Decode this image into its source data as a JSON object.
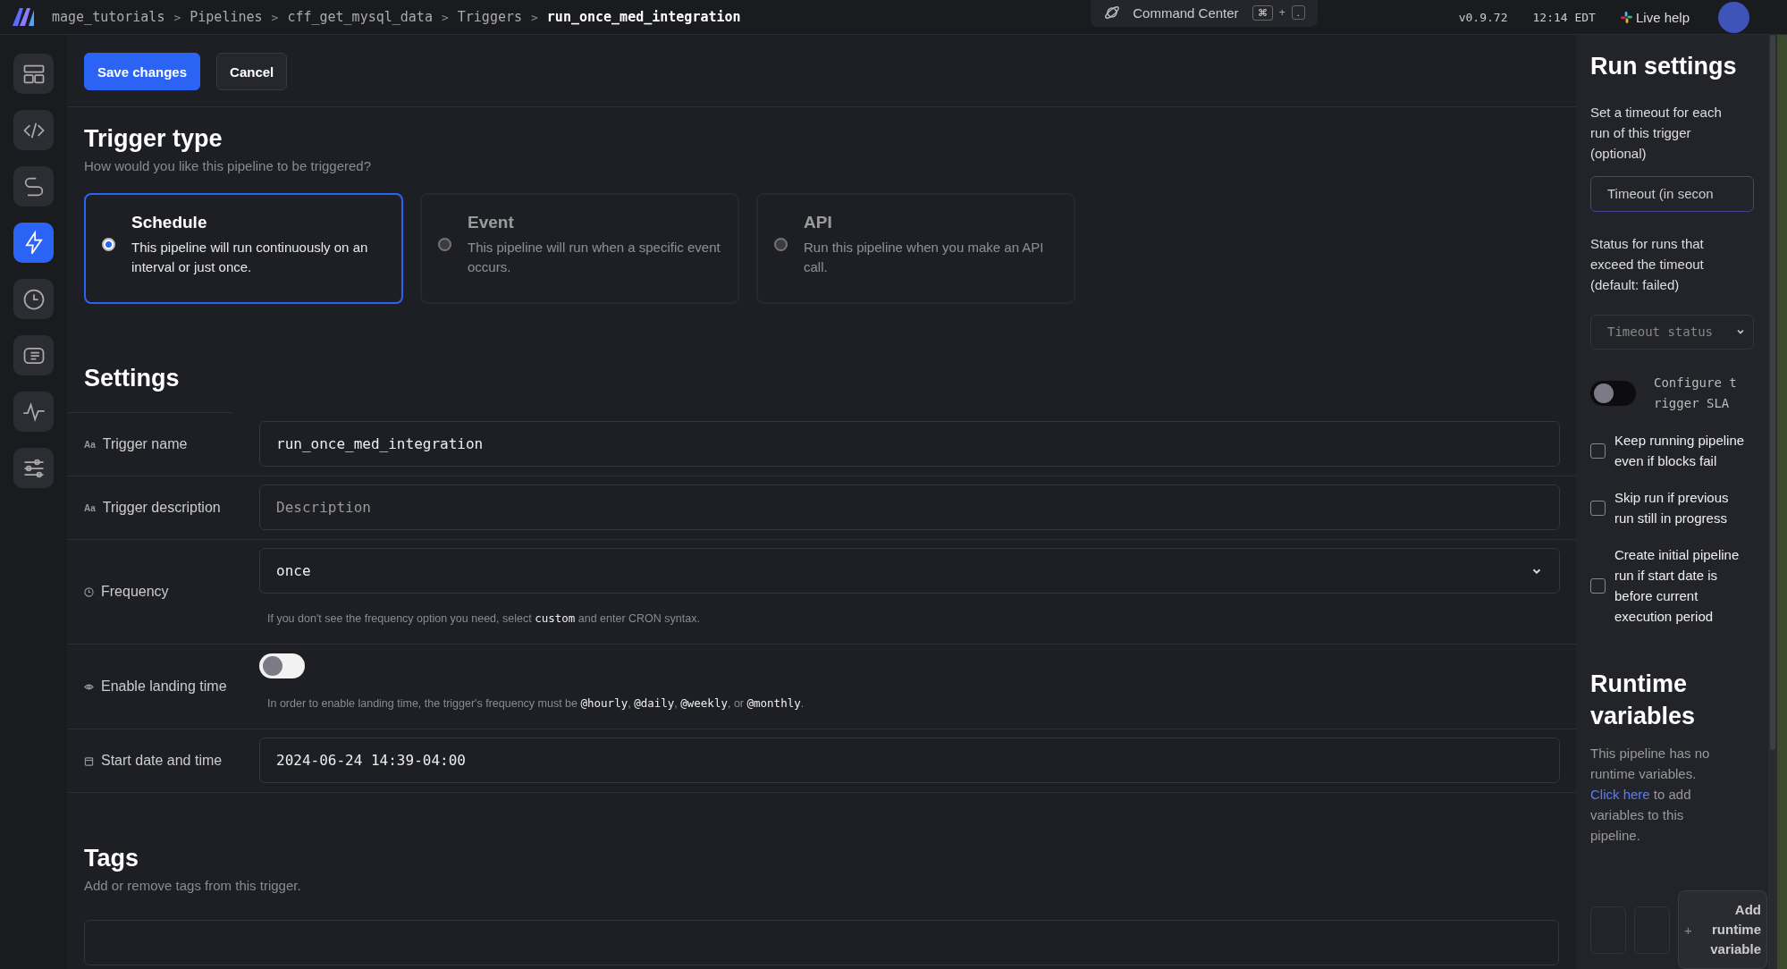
{
  "header": {
    "breadcrumbs": [
      {
        "label": "mage_tutorials",
        "current": false
      },
      {
        "label": "Pipelines",
        "current": false
      },
      {
        "label": "cff_get_mysql_data",
        "current": false
      },
      {
        "label": "Triggers",
        "current": false
      },
      {
        "label": "run_once_med_integration",
        "current": true
      }
    ],
    "separator": ">",
    "command_center": {
      "label": "Command Center",
      "keys": [
        "⌘",
        "+",
        "."
      ]
    },
    "version": "v0.9.72",
    "time": "12:14 EDT",
    "help": "Live help"
  },
  "sidebar": {
    "items": [
      {
        "selected": false
      },
      {
        "selected": false
      },
      {
        "selected": false
      },
      {
        "selected": true
      },
      {
        "selected": false
      },
      {
        "selected": false
      },
      {
        "selected": false
      },
      {
        "selected": false
      }
    ]
  },
  "actions": {
    "save": "Save changes",
    "cancel": "Cancel"
  },
  "trigger_type": {
    "title": "Trigger type",
    "subtitle": "How would you like this pipeline to be triggered?",
    "options": [
      {
        "title": "Schedule",
        "description": "This pipeline will run continuously on an interval or just once.",
        "selected": true
      },
      {
        "title": "Event",
        "description": "This pipeline will run when a specific event occurs.",
        "selected": false
      },
      {
        "title": "API",
        "description": "Run this pipeline when you make an API call.",
        "selected": false
      }
    ]
  },
  "settings": {
    "title": "Settings",
    "rows": [
      {
        "kind": "input",
        "icon_text": "Aa",
        "label": "Trigger name",
        "value": "run_once_med_integration"
      },
      {
        "kind": "input",
        "icon_text": "Aa",
        "label": "Trigger description",
        "placeholder": "Description"
      },
      {
        "kind": "select",
        "label": "Frequency",
        "value": "once",
        "hint": [
          {
            "kind": "text",
            "text": "If you don't see the frequency option you need, select "
          },
          {
            "kind": "code",
            "text": "custom"
          },
          {
            "kind": "text",
            "text": " and enter CRON syntax."
          }
        ]
      },
      {
        "kind": "toggle",
        "label": "Enable landing time",
        "on": false,
        "hint": [
          {
            "kind": "text",
            "text": "In order to enable landing time, the trigger's frequency must be "
          },
          {
            "kind": "code",
            "text": "@hourly"
          },
          {
            "kind": "text",
            "text": ", "
          },
          {
            "kind": "code",
            "text": "@daily"
          },
          {
            "kind": "text",
            "text": ", "
          },
          {
            "kind": "code",
            "text": "@weekly"
          },
          {
            "kind": "text",
            "text": ", or "
          },
          {
            "kind": "code",
            "text": "@monthly"
          },
          {
            "kind": "text",
            "text": "."
          }
        ]
      },
      {
        "kind": "input",
        "label": "Start date and time",
        "value": "2024-06-24 14:39-04:00"
      }
    ]
  },
  "tags": {
    "title": "Tags",
    "subtitle": "Add or remove tags from this trigger."
  },
  "run_settings": {
    "title": "Run settings",
    "timeout_label": "Set a timeout for each run of this trigger (optional)",
    "timeout_placeholder": "Timeout (in secon",
    "status_label": "Status for runs that exceed the timeout (default: failed)",
    "status_placeholder": "Timeout status",
    "sla": {
      "label": "Configure trigger SLA",
      "on": false
    },
    "options": [
      {
        "label": "Keep running pipeline even if blocks fail",
        "checked": false
      },
      {
        "label": "Skip run if previous run still in progress",
        "checked": false
      },
      {
        "label": "Create initial pipeline run if start date is before current execution period",
        "checked": false
      }
    ]
  },
  "runtime_variables": {
    "title": "Runtime variables",
    "text_before": "This pipeline has no runtime variables.",
    "link": "Click here",
    "text_after": "to add variables to this pipeline.",
    "add_icon": "+",
    "add_button": "Add runtime variable"
  }
}
